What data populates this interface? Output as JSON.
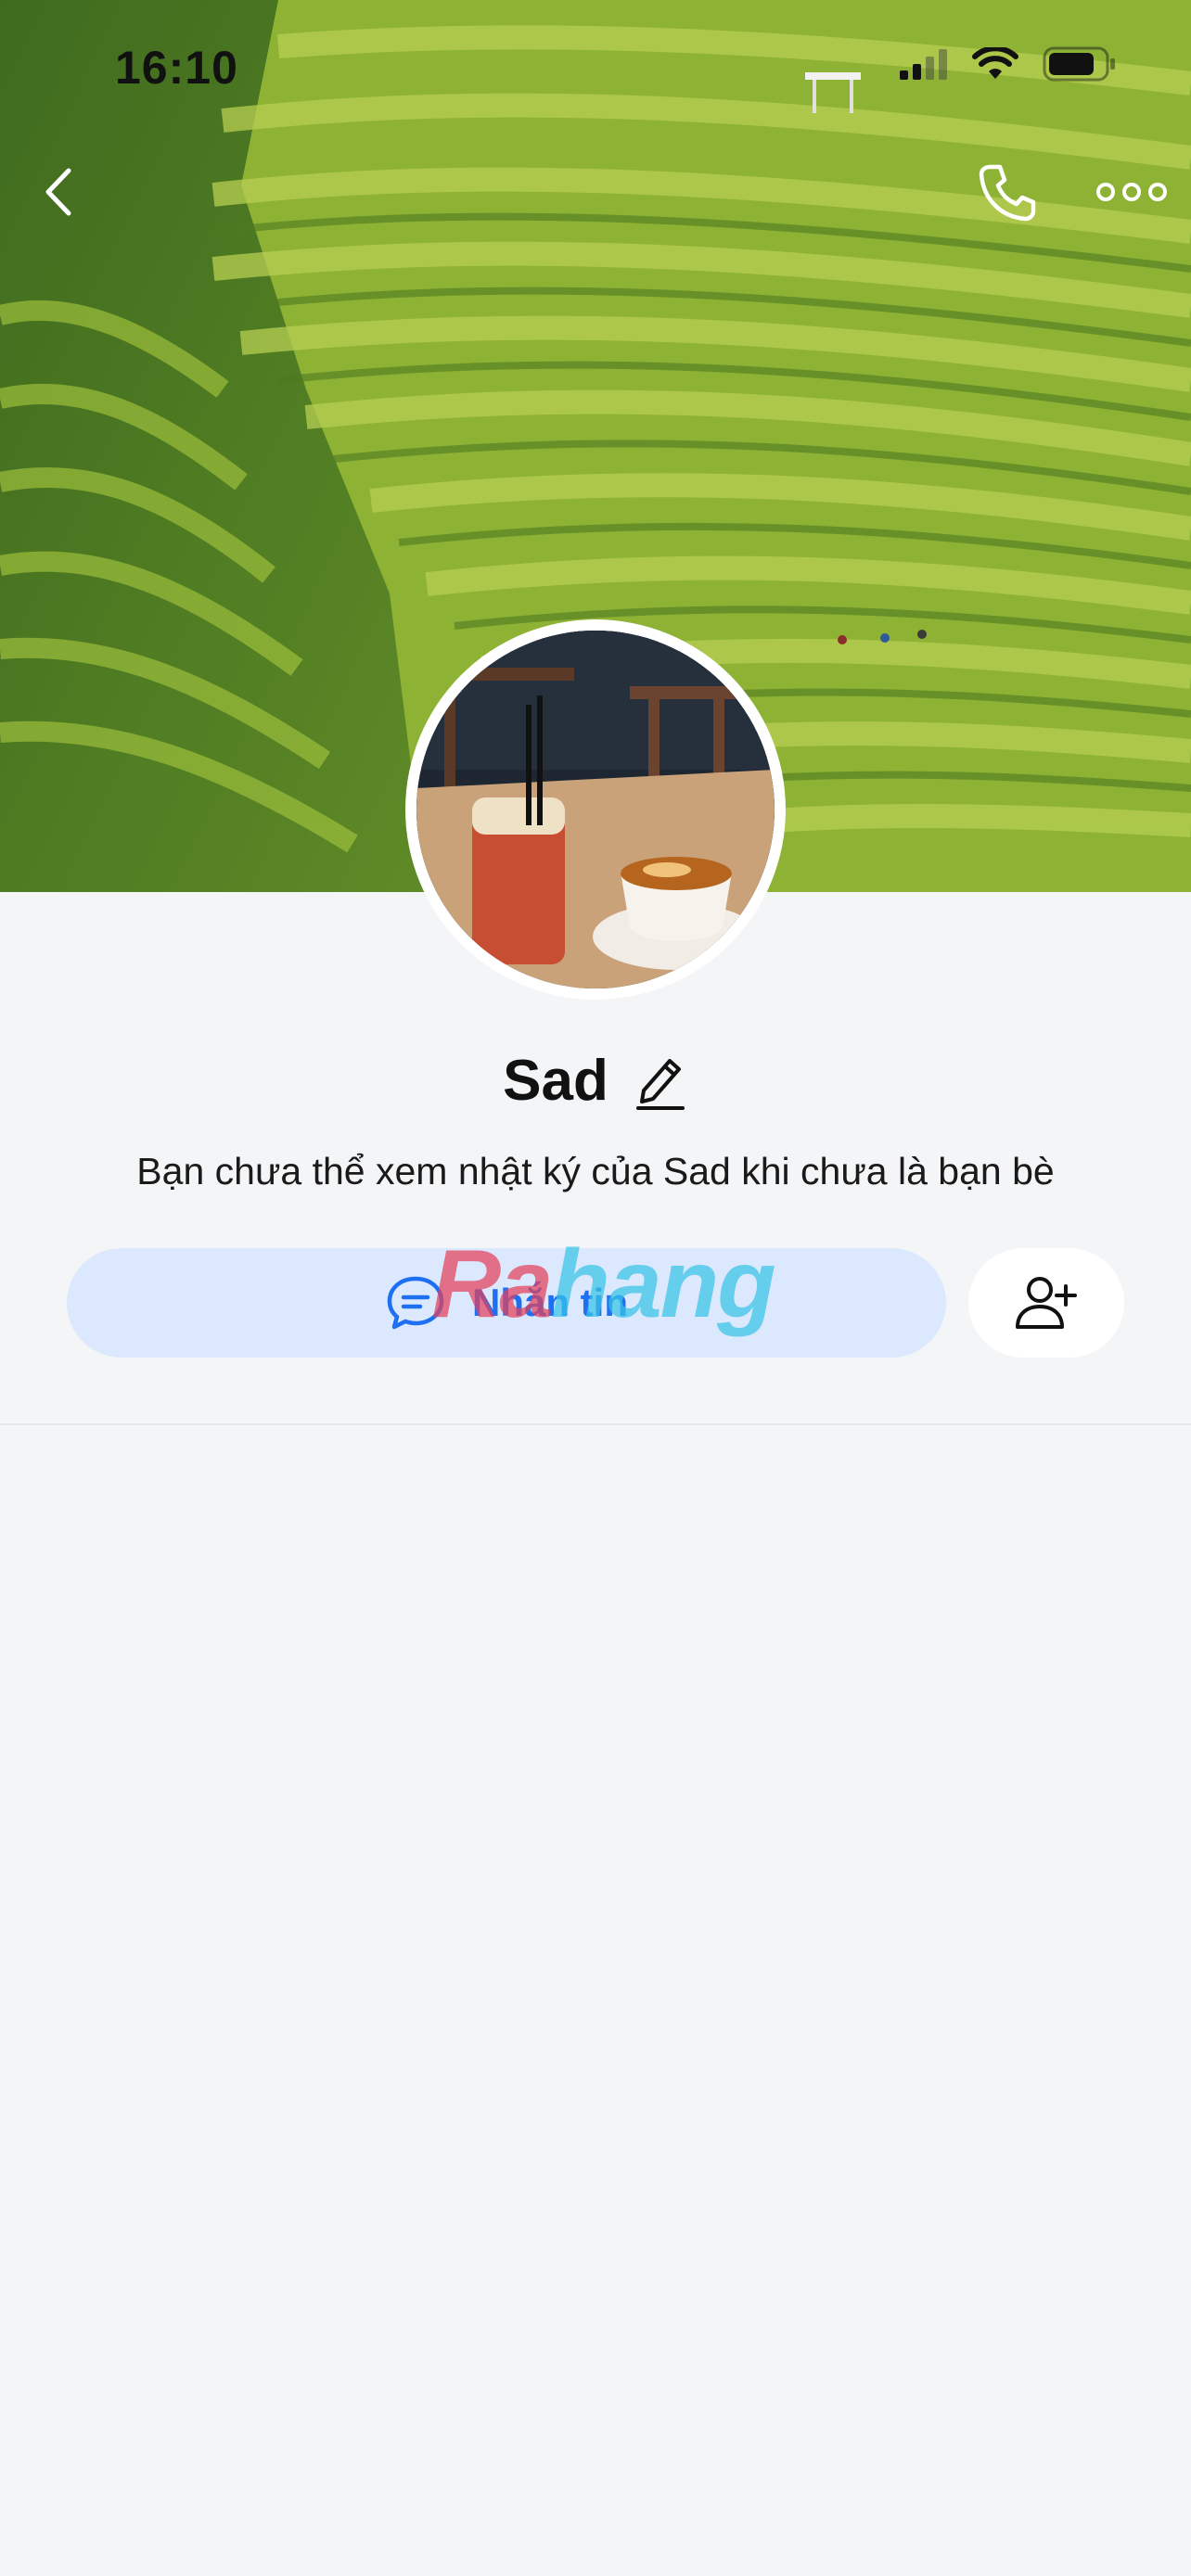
{
  "status_bar": {
    "time": "16:10"
  },
  "nav": {
    "back_icon": "chevron-left-icon",
    "call_icon": "phone-icon",
    "more_icon": "more-dots-icon"
  },
  "profile": {
    "name": "Sad",
    "edit_icon": "pencil-icon",
    "info_text": "Bạn chưa thể xem nhật ký của Sad khi chưa là bạn bè"
  },
  "actions": {
    "message_label": "Nhắn tin",
    "message_icon": "chat-bubble-icon",
    "add_friend_icon": "add-friend-icon"
  },
  "watermark": {
    "part_a": "Ra",
    "part_b": "hang"
  },
  "colors": {
    "accent": "#1f6ff2",
    "message_button_bg": "#dbe8fd",
    "page_bg": "#f4f5f7"
  }
}
